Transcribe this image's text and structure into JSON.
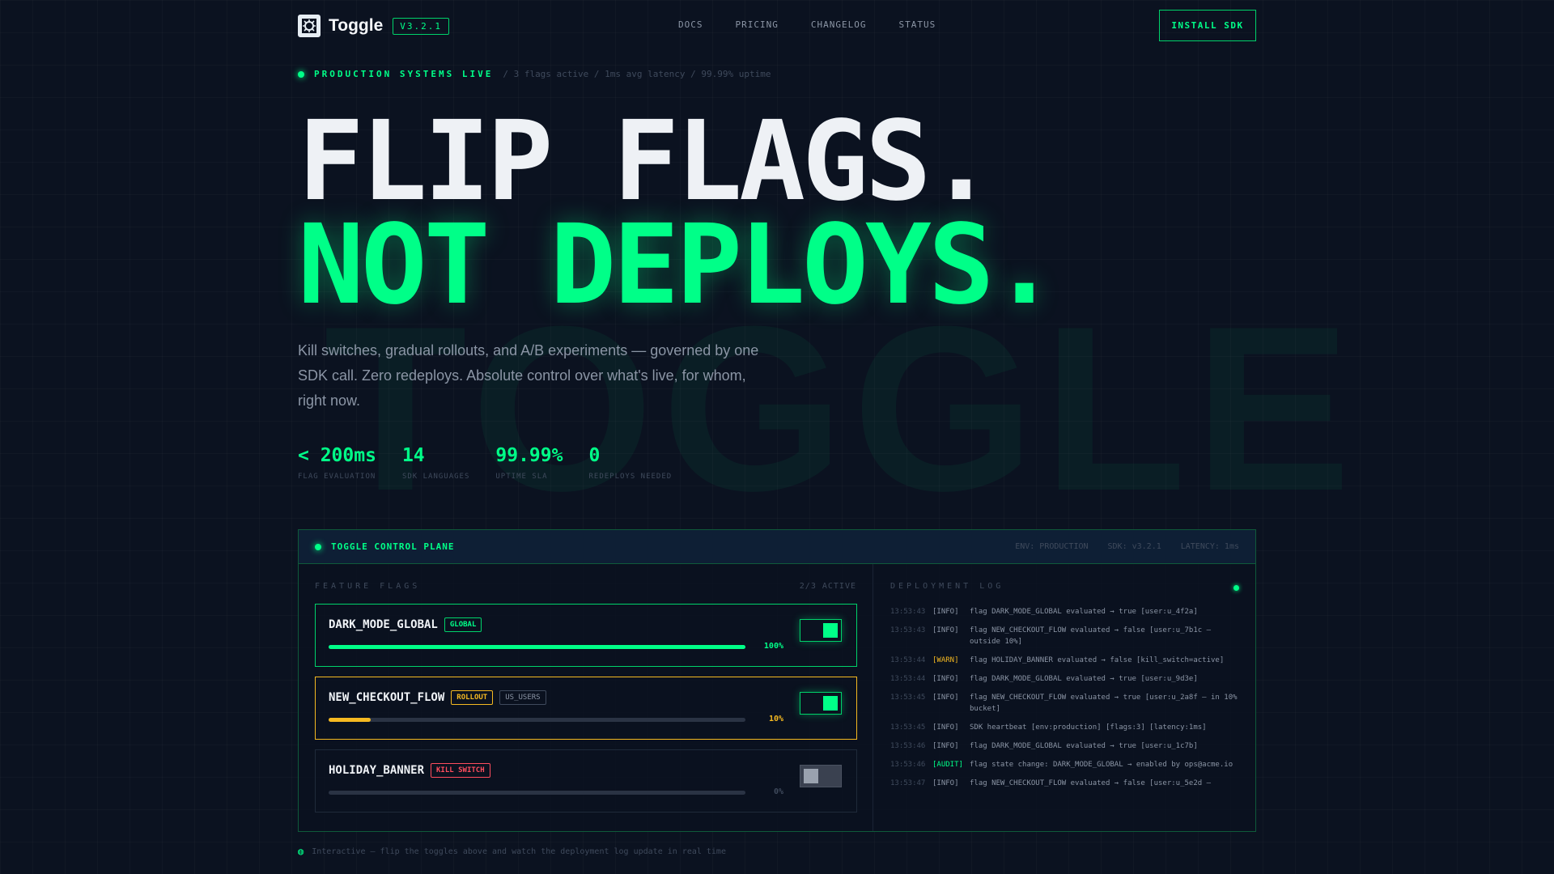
{
  "nav": {
    "brand": "Toggle",
    "version": "V3.2.1",
    "links": [
      "DOCS",
      "PRICING",
      "CHANGELOG",
      "STATUS"
    ],
    "cta": "INSTALL SDK"
  },
  "status": {
    "live": "PRODUCTION SYSTEMS LIVE",
    "meta": "/ 3 flags active / 1ms avg latency / 99.99% uptime"
  },
  "hero": {
    "line1": "FLIP FLAGS.",
    "line2": "NOT DEPLOYS.",
    "watermark": "TOGGLE",
    "lede": "Kill switches, gradual rollouts, and A/B experiments — governed by one SDK call. Zero redeploys. Absolute control over what's live, for whom, right now."
  },
  "stats": [
    {
      "value": "< 200ms",
      "label": "FLAG EVALUATION"
    },
    {
      "value": "14",
      "label": "SDK LANGUAGES"
    },
    {
      "value": "99.99%",
      "label": "UPTIME SLA"
    },
    {
      "value": "0",
      "label": "REDEPLOYS NEEDED"
    }
  ],
  "panel": {
    "title": "TOGGLE CONTROL PLANE",
    "env": "ENV: PRODUCTION",
    "sdk": "SDK: v3.2.1",
    "latency": "LATENCY: 1ms",
    "flags_heading": "FEATURE FLAGS",
    "flags_count": "2/3 ACTIVE",
    "log_heading": "DEPLOYMENT LOG"
  },
  "flags": [
    {
      "name": "DARK_MODE_GLOBAL",
      "tags": [
        "GLOBAL"
      ],
      "rollout": 1.0,
      "pct": "100%",
      "enabled": true,
      "color": "#00ff88"
    },
    {
      "name": "NEW_CHECKOUT_FLOW",
      "tags": [
        "ROLLOUT",
        "US_USERS"
      ],
      "rollout": 0.1,
      "pct": "10%",
      "enabled": true,
      "color": "#f5b921"
    },
    {
      "name": "HOLIDAY_BANNER",
      "tags": [
        "KILL SWITCH"
      ],
      "rollout": 0.0,
      "pct": "0%",
      "enabled": false,
      "color": "#3f4a5c"
    }
  ],
  "log": [
    {
      "time": "13:53:43",
      "level": "[INFO]",
      "msg": "flag DARK_MODE_GLOBAL evaluated → true [user:u_4f2a]"
    },
    {
      "time": "13:53:43",
      "level": "[INFO]",
      "msg": "flag NEW_CHECKOUT_FLOW evaluated → false [user:u_7b1c — outside 10%]"
    },
    {
      "time": "13:53:44",
      "level": "[WARN]",
      "msg": "flag HOLIDAY_BANNER evaluated → false [kill_switch=active]"
    },
    {
      "time": "13:53:44",
      "level": "[INFO]",
      "msg": "flag DARK_MODE_GLOBAL evaluated → true [user:u_9d3e]"
    },
    {
      "time": "13:53:45",
      "level": "[INFO]",
      "msg": "flag NEW_CHECKOUT_FLOW evaluated → true [user:u_2a8f — in 10% bucket]"
    },
    {
      "time": "13:53:45",
      "level": "[INFO]",
      "msg": "SDK heartbeat [env:production] [flags:3] [latency:1ms]"
    },
    {
      "time": "13:53:46",
      "level": "[INFO]",
      "msg": "flag DARK_MODE_GLOBAL evaluated → true [user:u_1c7b]"
    },
    {
      "time": "13:53:46",
      "level": "[AUDIT]",
      "msg": "flag state change: DARK_MODE_GLOBAL → enabled by ops@acme.io"
    },
    {
      "time": "13:53:47",
      "level": "[INFO]",
      "msg": "flag NEW_CHECKOUT_FLOW evaluated → false [user:u_5e2d —"
    }
  ],
  "hint": "Interactive — flip the toggles above and watch the deployment log update in real time",
  "colors": {
    "accent": "#00ff88",
    "amber": "#f5b921",
    "danger": "#ff4d5e",
    "bg": "#0b1220"
  }
}
